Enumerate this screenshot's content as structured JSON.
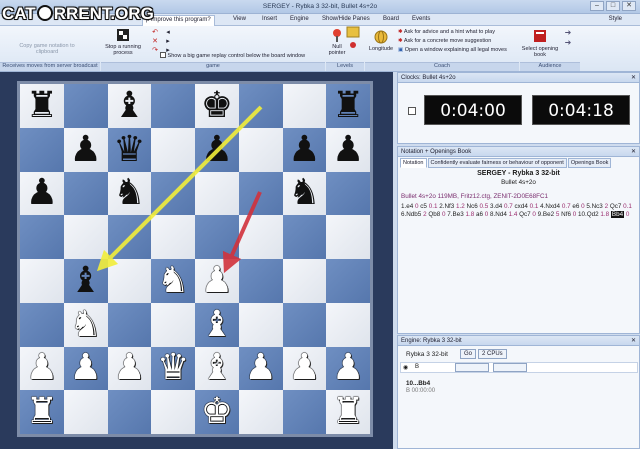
{
  "window": {
    "title": "SERGEY - Rybka 3 32-bit, Bullet 4s+2o",
    "min": "–",
    "max": "□",
    "close": "✕"
  },
  "menu_tabs": [
    "p improve this program?",
    "View",
    "Insert",
    "Engine",
    "Show/Hide Panes",
    "Board",
    "Events"
  ],
  "style_menu": "Style",
  "watermark": "CATORRENT.ORG",
  "ribbon": {
    "copy_game": "Copy game notation to clipboard",
    "stop_process": "Stop a running process",
    "show_replay": "Show a big game replay control below the board window",
    "null_pointer": "Null pointer",
    "longitude": "Longitude",
    "advice_hint": "Ask for advice and a hint what to play",
    "concrete_move": "Ask for a concrete move suggestion",
    "open_window_legal": "Open a window explaining all legal moves",
    "select_book": "Select opening book",
    "groups": {
      "receive": "Receives moves from server broadcast",
      "game": "game",
      "levels": "Levels",
      "coach": "Coach",
      "audience": "Audience"
    }
  },
  "clocks": {
    "header": "Clocks: Bullet 4s+2o",
    "white": "0:04:00",
    "black": "0:04:18"
  },
  "notation": {
    "header": "Notation + Openings Book",
    "tabs": [
      "Notation",
      "Confidently evaluate fairness or behaviour of opponent",
      "Openings Book"
    ],
    "players": "SERGEY - Rybka 3 32-bit",
    "event": "Bullet 4s+2o",
    "info": "Bullet 4s+2o  119MB, Fritz12.ctg, ZENIT-2D0E68FC1",
    "moves": [
      {
        "t": "1.e4",
        "c": ""
      },
      {
        "t": "0",
        "c": "g"
      },
      {
        "t": "c5",
        "c": ""
      },
      {
        "t": "0.1",
        "c": "g"
      },
      {
        "t": "2.Nf3",
        "c": ""
      },
      {
        "t": "1.2",
        "c": "g"
      },
      {
        "t": "Nc6",
        "c": ""
      },
      {
        "t": "0.5",
        "c": "g"
      },
      {
        "t": "3.d4",
        "c": ""
      },
      {
        "t": "0.7",
        "c": "g"
      },
      {
        "t": "cxd4",
        "c": ""
      },
      {
        "t": "0.1",
        "c": "g"
      },
      {
        "t": "4.Nxd4",
        "c": ""
      },
      {
        "t": "0.7",
        "c": "g"
      },
      {
        "t": "e6",
        "c": ""
      },
      {
        "t": "0",
        "c": "g"
      },
      {
        "t": "5.Nc3",
        "c": ""
      },
      {
        "t": "2",
        "c": "g"
      },
      {
        "t": "Qc7",
        "c": ""
      },
      {
        "t": "0.1",
        "c": "g"
      },
      {
        "t": "6.Ndb5",
        "c": ""
      },
      {
        "t": "2",
        "c": "g"
      },
      {
        "t": "Qb8",
        "c": ""
      },
      {
        "t": "0",
        "c": "g"
      },
      {
        "t": "7.Be3",
        "c": ""
      },
      {
        "t": "1.8",
        "c": "g"
      },
      {
        "t": "a6",
        "c": ""
      },
      {
        "t": "0",
        "c": "g"
      },
      {
        "t": "8.Nd4",
        "c": ""
      },
      {
        "t": "1.4",
        "c": "g"
      },
      {
        "t": "Qc7",
        "c": ""
      },
      {
        "t": "0",
        "c": "g"
      },
      {
        "t": "9.Be2",
        "c": ""
      },
      {
        "t": "5",
        "c": "g"
      },
      {
        "t": "Nf6",
        "c": ""
      },
      {
        "t": "0",
        "c": "g"
      },
      {
        "t": "10.Qd2",
        "c": ""
      },
      {
        "t": "1.8",
        "c": "g"
      },
      {
        "t": "Bb4",
        "c": "h"
      },
      {
        "t": "0",
        "c": "g"
      }
    ]
  },
  "engine": {
    "header": "Engine: Rybka 3 32-bit",
    "name": "Rybka 3 32-bit",
    "go": "Go",
    "cpus": "2 CPUs",
    "side": "B",
    "line1": "10...Bb4",
    "line2": "B   00:00:00"
  },
  "board": {
    "rows": [
      [
        "bR",
        "",
        "bB",
        "",
        "bK",
        "",
        "",
        "bR"
      ],
      [
        "",
        "bP",
        "bQ",
        "",
        "bP",
        "",
        "bP",
        "bP"
      ],
      [
        "bP",
        "",
        "bN",
        "",
        "",
        "",
        "bN",
        ""
      ],
      [
        "",
        "",
        "",
        "",
        "",
        "",
        "",
        ""
      ],
      [
        "",
        "bB",
        "",
        "wN",
        "wP",
        "",
        "",
        ""
      ],
      [
        "",
        "wN",
        "",
        "",
        "wB",
        "",
        "",
        ""
      ],
      [
        "wP",
        "wP",
        "wP",
        "wQ",
        "wB",
        "wP",
        "wP",
        "wP"
      ],
      [
        "wR",
        "",
        "",
        "",
        "wK",
        "",
        "",
        "wR"
      ]
    ],
    "arrow_colors": {
      "yellow": "#f2ee3a",
      "red": "#d2323c"
    }
  },
  "colors": {
    "ribbon_blue": "#dbe6f4",
    "board_dark": "#5677ad",
    "board_light": "#eef1f6",
    "frame": "#2a3a5c"
  }
}
